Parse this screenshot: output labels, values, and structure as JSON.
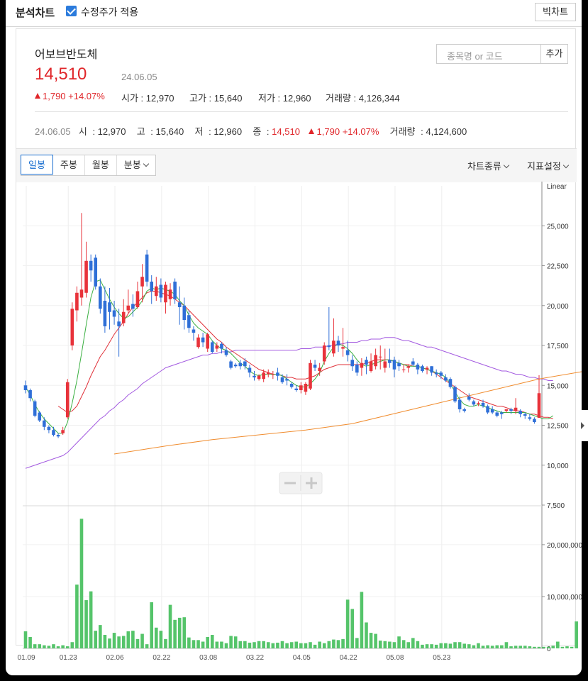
{
  "topbar": {
    "title": "분석차트",
    "adjusted_label": "수정주가 적용",
    "big_chart_label": "빅차트"
  },
  "stock": {
    "name": "어보브반도체",
    "price": "14,510",
    "date": "24.06.05",
    "change": "1,790 +14.07%",
    "open_label": "시가",
    "open": "12,970",
    "high_label": "고가",
    "high": "15,640",
    "low_label": "저가",
    "low": "12,960",
    "volume_label": "거래량",
    "volume": "4,126,344"
  },
  "search": {
    "placeholder": "종목명 or 코드",
    "button": "추가"
  },
  "daily": {
    "date": "24.06.05",
    "o_label": "시",
    "o": "12,970",
    "h_label": "고",
    "h": "15,640",
    "l_label": "저",
    "l": "12,960",
    "c_label": "종",
    "c": "14,510",
    "chg": "1,790 +14.07%",
    "v_label": "거래량",
    "v": "4,124,600"
  },
  "toolbar": {
    "tabs": [
      "일봉",
      "주봉",
      "월봉",
      "분봉"
    ],
    "active_tab": "일봉",
    "chart_type": "차트종류",
    "indicator": "지표설정"
  },
  "colors": {
    "up": "#e8323a",
    "down": "#2f6fd7",
    "ma5": "#3cb043",
    "ma20": "#e0323a",
    "ma60": "#a35ae0",
    "ma120": "#f08c2e",
    "volume": "#55c46a"
  },
  "chart_data": {
    "type": "candlestick",
    "scale_label": "Linear",
    "price_ticks": [
      "25,000",
      "22,500",
      "20,000",
      "17,500",
      "15,000",
      "12,500",
      "10,000",
      "7,500"
    ],
    "volume_ticks": [
      "20,000,000",
      "10,000,000",
      "0"
    ],
    "x_ticks": [
      "01.09",
      "01.23",
      "02.06",
      "02.22",
      "03.08",
      "03.22",
      "04.05",
      "04.22",
      "05.08",
      "05.23"
    ],
    "candles": [
      [
        15000,
        14700,
        15300,
        14500
      ],
      [
        14700,
        14200,
        14800,
        14000
      ],
      [
        14000,
        13100,
        14100,
        13000
      ],
      [
        13300,
        12800,
        13400,
        12700
      ],
      [
        12800,
        12400,
        13000,
        12200
      ],
      [
        12400,
        12200,
        12500,
        12000
      ],
      [
        12200,
        11900,
        12400,
        11800
      ],
      [
        11900,
        11800,
        12000,
        11700
      ],
      [
        12000,
        12200,
        12400,
        11900
      ],
      [
        13000,
        15200,
        15400,
        12900
      ],
      [
        17500,
        19800,
        20200,
        17200
      ],
      [
        19700,
        20800,
        21200,
        19000
      ],
      [
        20500,
        21000,
        25800,
        20000
      ],
      [
        20800,
        22800,
        24000,
        20500
      ],
      [
        22800,
        22200,
        23200,
        21500
      ],
      [
        23000,
        21200,
        23200,
        21000
      ],
      [
        21200,
        19800,
        21700,
        19500
      ],
      [
        20300,
        18700,
        21200,
        18300
      ],
      [
        20200,
        19600,
        21100,
        18500
      ],
      [
        19700,
        19300,
        20300,
        18800
      ],
      [
        19000,
        18700,
        19800,
        16800
      ],
      [
        18900,
        19600,
        20400,
        18700
      ],
      [
        19700,
        20000,
        21000,
        19500
      ],
      [
        20100,
        19800,
        20700,
        19300
      ],
      [
        19900,
        20900,
        21500,
        19800
      ],
      [
        21200,
        21800,
        22600,
        20200
      ],
      [
        23200,
        21500,
        23500,
        21200
      ],
      [
        21500,
        20900,
        21900,
        20100
      ],
      [
        20600,
        21200,
        21800,
        20300
      ],
      [
        21300,
        20500,
        21700,
        20200
      ],
      [
        20200,
        21300,
        21500,
        19500
      ],
      [
        20400,
        21000,
        21400,
        20000
      ],
      [
        21500,
        20400,
        21700,
        20100
      ],
      [
        20200,
        19900,
        21200,
        18800
      ],
      [
        20000,
        19100,
        20500,
        18500
      ],
      [
        19400,
        18600,
        19700,
        18300
      ],
      [
        18500,
        18300,
        18700,
        17800
      ],
      [
        17400,
        18000,
        18200,
        17300
      ],
      [
        18000,
        17700,
        18300,
        17400
      ],
      [
        17300,
        18200,
        18300,
        17100
      ],
      [
        17700,
        17100,
        17800,
        17000
      ],
      [
        17300,
        17500,
        17700,
        17100
      ],
      [
        17600,
        17300,
        17700,
        17000
      ],
      [
        17200,
        16900,
        17400,
        16800
      ],
      [
        16500,
        16100,
        16600,
        16000
      ],
      [
        16300,
        16200,
        16400,
        16100
      ],
      [
        16400,
        16200,
        16600,
        16000
      ],
      [
        16500,
        16200,
        16700,
        16000
      ],
      [
        16100,
        15800,
        16300,
        15500
      ],
      [
        15600,
        15500,
        15900,
        15300
      ],
      [
        15400,
        15600,
        15700,
        15300
      ],
      [
        15400,
        15800,
        16000,
        15200
      ],
      [
        15700,
        15800,
        16000,
        15500
      ],
      [
        15700,
        15700,
        15900,
        15400
      ],
      [
        15800,
        15600,
        16100,
        15300
      ],
      [
        15500,
        15200,
        15700,
        15100
      ],
      [
        15400,
        15300,
        15700,
        15000
      ],
      [
        15100,
        14900,
        15200,
        14800
      ],
      [
        14800,
        14700,
        15000,
        14600
      ],
      [
        14700,
        15000,
        15200,
        14500
      ],
      [
        14600,
        15100,
        15200,
        14400
      ],
      [
        14800,
        16400,
        16600,
        14700
      ],
      [
        16300,
        16100,
        16600,
        15900
      ],
      [
        15900,
        16100,
        16400,
        15600
      ],
      [
        16500,
        17500,
        17700,
        16300
      ],
      [
        17500,
        17400,
        19900,
        17200
      ],
      [
        17000,
        17800,
        19200,
        16800
      ],
      [
        17800,
        17500,
        18100,
        17100
      ],
      [
        17300,
        17400,
        18600,
        16800
      ],
      [
        17200,
        16900,
        17800,
        16500
      ],
      [
        16600,
        16200,
        16900,
        15900
      ],
      [
        16300,
        15800,
        16500,
        15600
      ],
      [
        16100,
        16400,
        16700,
        15600
      ],
      [
        16600,
        16300,
        16800,
        15700
      ],
      [
        15900,
        16500,
        17000,
        15800
      ],
      [
        16200,
        16900,
        17300,
        16000
      ],
      [
        16800,
        16800,
        17500,
        16000
      ],
      [
        16100,
        16500,
        17300,
        15800
      ],
      [
        16600,
        16400,
        17300,
        16100
      ],
      [
        16600,
        16000,
        16800,
        15500
      ],
      [
        16400,
        16200,
        16600,
        15900
      ],
      [
        16000,
        16000,
        16300,
        15800
      ],
      [
        16100,
        16200,
        16300,
        15800
      ],
      [
        16500,
        16300,
        16700,
        16200
      ],
      [
        16300,
        16000,
        16400,
        15700
      ],
      [
        16200,
        15900,
        16300,
        15800
      ],
      [
        16000,
        16100,
        16200,
        15700
      ],
      [
        16200,
        15800,
        16200,
        15600
      ],
      [
        15800,
        15700,
        16000,
        15500
      ],
      [
        15800,
        15600,
        15900,
        15400
      ],
      [
        15500,
        15300,
        15700,
        15200
      ],
      [
        15400,
        14900,
        15500,
        14800
      ],
      [
        14900,
        14000,
        15000,
        13900
      ],
      [
        14100,
        13500,
        14300,
        13300
      ],
      [
        13500,
        13400,
        13600,
        13300
      ],
      [
        14300,
        14100,
        14500,
        14000
      ],
      [
        14000,
        13800,
        14100,
        13700
      ],
      [
        13900,
        13900,
        14000,
        13700
      ],
      [
        13900,
        13700,
        14100,
        13600
      ],
      [
        13700,
        13300,
        13800,
        13200
      ],
      [
        13500,
        13300,
        13700,
        13200
      ],
      [
        13300,
        13100,
        13400,
        13000
      ],
      [
        13300,
        13200,
        13400,
        12900
      ],
      [
        13400,
        13500,
        13500,
        13300
      ],
      [
        13500,
        13400,
        13600,
        13200
      ],
      [
        13400,
        13600,
        14200,
        13200
      ],
      [
        13400,
        13200,
        13500,
        13000
      ],
      [
        13200,
        13100,
        13300,
        12900
      ],
      [
        13000,
        12900,
        13200,
        12800
      ],
      [
        12900,
        12700,
        13000,
        12600
      ],
      [
        12970,
        14510,
        15640,
        12960
      ]
    ],
    "volumes_m": [
      3.3,
      2.2,
      0.8,
      0.8,
      0.6,
      0.5,
      0.8,
      0.4,
      0.6,
      0.4,
      1.2,
      12.3,
      25.0,
      9.3,
      11.0,
      3.4,
      4.5,
      2.6,
      1.9,
      3.0,
      2.3,
      2.4,
      3.3,
      3.4,
      1.8,
      2.8,
      0.8,
      8.9,
      4.0,
      3.4,
      1.8,
      8.4,
      5.5,
      5.9,
      6.0,
      2.1,
      1.6,
      1.6,
      1.3,
      2.2,
      2.6,
      1.3,
      1.3,
      1.0,
      2.4,
      2.3,
      1.4,
      1.4,
      1.1,
      1.2,
      1.4,
      1.4,
      1.2,
      1.0,
      1.1,
      1.4,
      1.0,
      1.2,
      1.3,
      1.0,
      1.0,
      1.2,
      0.7,
      1.3,
      1.0,
      1.4,
      1.7,
      1.6,
      1.8,
      9.4,
      7.6,
      2.0,
      10.9,
      5.0,
      3.0,
      2.8,
      1.5,
      1.4,
      1.3,
      1.2,
      2.3,
      1.6,
      1.2,
      2.0,
      1.4,
      0.7,
      0.8,
      0.8,
      0.7,
      1.0,
      1.0,
      0.9,
      1.2,
      1.2,
      0.9,
      0.8,
      0.6,
      1.0,
      0.5,
      0.6,
      0.5,
      0.6,
      0.6,
      1.2,
      0.4,
      0.5,
      0.5,
      0.5,
      0.4,
      0.3,
      0.3,
      0.3,
      0.3,
      0.5,
      1.3,
      0.3,
      0.4,
      0.3,
      5.2
    ],
    "ma5": [
      14900,
      14400,
      13800,
      13300,
      12900,
      12600,
      12300,
      12000,
      12000,
      12700,
      13900,
      15300,
      17000,
      18800,
      20500,
      21500,
      21600,
      21000,
      20400,
      19900,
      19500,
      19200,
      19300,
      19600,
      19900,
      20300,
      20900,
      21100,
      21000,
      21100,
      21000,
      20900,
      20700,
      20300,
      20000,
      19400,
      18900,
      18600,
      18400,
      18200,
      17800,
      17500,
      17300,
      17200,
      17000,
      16700,
      16400,
      16200,
      15900,
      15700,
      15600,
      15700,
      15700,
      15700,
      15700,
      15600,
      15400,
      15200,
      15000,
      14900,
      14900,
      15100,
      15400,
      15800,
      16500,
      17000,
      17400,
      17600,
      17500,
      17300,
      17000,
      16600,
      16300,
      16200,
      16300,
      16400,
      16500,
      16600,
      16600,
      16500,
      16400,
      16300,
      16200,
      16200,
      16200,
      16100,
      16000,
      15900,
      15800,
      15700,
      15500,
      15100,
      14600,
      14100,
      13800,
      13700,
      13700,
      13800,
      13700,
      13600,
      13500,
      13400,
      13300,
      13300,
      13300,
      13300,
      13300,
      13300,
      13200,
      13100,
      13000,
      12900,
      12900,
      13100
    ],
    "ma20": [
      null,
      null,
      null,
      null,
      null,
      null,
      null,
      13700,
      13500,
      13300,
      13400,
      13700,
      14300,
      14900,
      15600,
      16200,
      16800,
      17200,
      17700,
      18200,
      18600,
      19000,
      19500,
      19900,
      20200,
      20500,
      20800,
      20900,
      20900,
      20800,
      20700,
      20600,
      20400,
      20200,
      20000,
      19700,
      19400,
      19100,
      18800,
      18500,
      18200,
      17900,
      17700,
      17400,
      17200,
      17000,
      16800,
      16600,
      16400,
      16200,
      16000,
      15900,
      15800,
      15700,
      15700,
      15600,
      15500,
      15500,
      15400,
      15400,
      15400,
      15500,
      15600,
      15800,
      16000,
      16100,
      16200,
      16300,
      16300,
      16300,
      16300,
      16300,
      16300,
      16400,
      16500,
      16600,
      16600,
      16600,
      16600,
      16500,
      16400,
      16300,
      16300,
      16200,
      16200,
      16100,
      16000,
      15900,
      15700,
      15500,
      15300,
      15100,
      14900,
      14700,
      14500,
      14300,
      14200,
      14100,
      14000,
      13900,
      13800,
      13700,
      13700,
      13600,
      13500,
      13400,
      13400,
      13300,
      13200,
      13200,
      13100,
      13000,
      13000,
      12900
    ],
    "ma60": [
      9800,
      9900,
      10000,
      10100,
      10200,
      10300,
      10400,
      10500,
      10600,
      10800,
      11100,
      11400,
      11700,
      12000,
      12300,
      12600,
      12900,
      13100,
      13400,
      13600,
      13900,
      14100,
      14400,
      14600,
      14800,
      15100,
      15300,
      15500,
      15700,
      15900,
      16100,
      16200,
      16300,
      16400,
      16500,
      16600,
      16700,
      16800,
      16900,
      16900,
      17000,
      17000,
      17100,
      17100,
      17100,
      17200,
      17200,
      17200,
      17200,
      17200,
      17200,
      17200,
      17200,
      17200,
      17200,
      17200,
      17200,
      17200,
      17200,
      17300,
      17300,
      17300,
      17400,
      17400,
      17400,
      17500,
      17500,
      17600,
      17600,
      17700,
      17700,
      17700,
      17800,
      17800,
      17900,
      17900,
      17900,
      18000,
      18000,
      18000,
      17900,
      17800,
      17800,
      17700,
      17600,
      17500,
      17400,
      17400,
      17300,
      17200,
      17100,
      17000,
      16900,
      16800,
      16700,
      16600,
      16500,
      16400,
      16300,
      16200,
      16100,
      16000,
      15900,
      15900,
      15800,
      15700,
      15700,
      15600,
      15500,
      15500,
      15400,
      15400,
      15300,
      15300
    ],
    "ma120": [
      {
        "i": 19,
        "v": 10700
      },
      {
        "i": 30,
        "v": 11200
      },
      {
        "i": 40,
        "v": 11600
      },
      {
        "i": 50,
        "v": 11900
      },
      {
        "i": 60,
        "v": 12200
      },
      {
        "i": 70,
        "v": 12600
      },
      {
        "i": 80,
        "v": 13300
      },
      {
        "i": 90,
        "v": 14000
      },
      {
        "i": 100,
        "v": 14700
      },
      {
        "i": 110,
        "v": 15400
      },
      {
        "i": 120,
        "v": 15900
      }
    ]
  }
}
